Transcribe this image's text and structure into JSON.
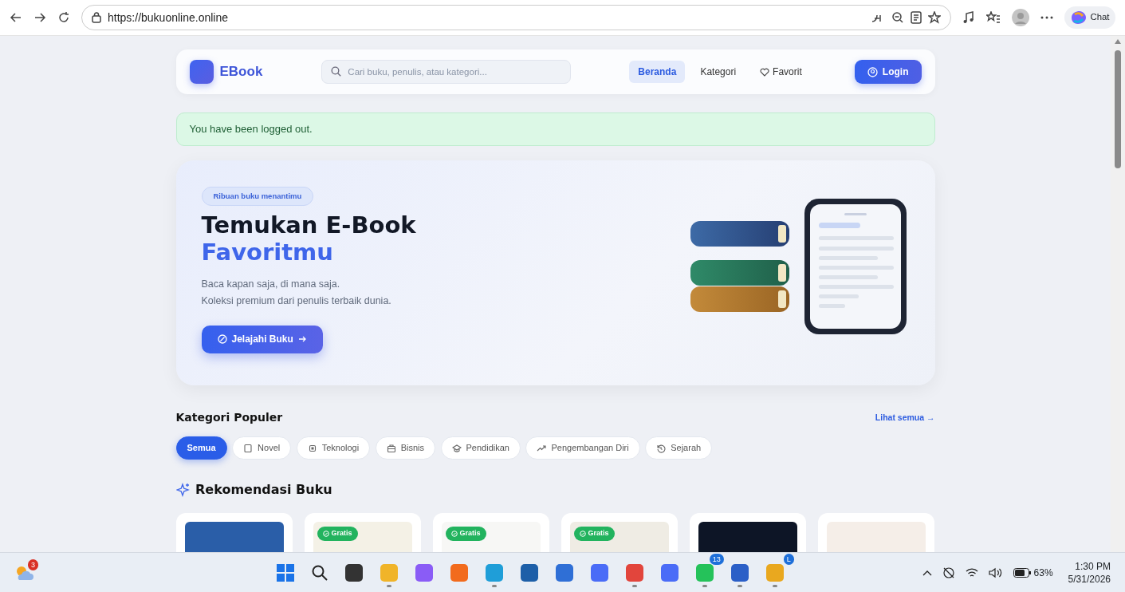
{
  "browser": {
    "url": "https://bukuonline.online",
    "chat_label": "Chat"
  },
  "navbar": {
    "brand": "EBook",
    "search_placeholder": "Cari buku, penulis, atau kategori...",
    "links": [
      {
        "label": "Beranda",
        "selected": true,
        "kind": "plain"
      },
      {
        "label": "Kategori",
        "selected": false,
        "kind": "plain"
      },
      {
        "label": "Favorit",
        "selected": false,
        "kind": "heart"
      }
    ],
    "login": "Login"
  },
  "alert": "You have been logged out.",
  "hero": {
    "badge": "Ribuan buku menantimu",
    "title_line1": "Temukan E-Book",
    "title_line2": "Favoritmu",
    "lines": [
      "Baca kapan saja, di mana saja.",
      "Koleksi premium dari penulis terbaik dunia."
    ],
    "button": "Jelajahi Buku"
  },
  "categories": {
    "title": "Kategori Populer",
    "see_all": "Lihat semua →",
    "chips": [
      {
        "label": "Semua",
        "selected": true,
        "kind": "none"
      },
      {
        "label": "Novel",
        "selected": false,
        "kind": "book"
      },
      {
        "label": "Teknologi",
        "selected": false,
        "kind": "chip"
      },
      {
        "label": "Bisnis",
        "selected": false,
        "kind": "case"
      },
      {
        "label": "Pendidikan",
        "selected": false,
        "kind": "cap"
      },
      {
        "label": "Pengembangan Diri",
        "selected": false,
        "kind": "trend"
      },
      {
        "label": "Sejarah",
        "selected": false,
        "kind": "history"
      }
    ]
  },
  "recommend": {
    "title": "Rekomendasi Buku",
    "books": [
      {
        "color": "#2a5ea8"
      },
      {
        "color": "#f4f1e6",
        "badge": "Gratis"
      },
      {
        "color": "#f7f7f5",
        "badge": "Gratis"
      },
      {
        "color": "#efece4",
        "badge": "Gratis"
      },
      {
        "color": "#0d1526"
      },
      {
        "color": "#f5eee8"
      }
    ]
  },
  "taskbar": {
    "weather_badge": "3",
    "apps": [
      {
        "running": false
      },
      {
        "running": true
      },
      {
        "running": false
      },
      {
        "running": false
      },
      {
        "running": true
      },
      {
        "running": false
      },
      {
        "running": false
      },
      {
        "running": false
      },
      {
        "running": true
      },
      {
        "running": false
      },
      {
        "running": true,
        "badge": "13"
      },
      {
        "running": true
      },
      {
        "running": true,
        "badge": "L"
      }
    ],
    "battery": "63%",
    "time": "1:30 PM",
    "date": "5/31/2026"
  }
}
